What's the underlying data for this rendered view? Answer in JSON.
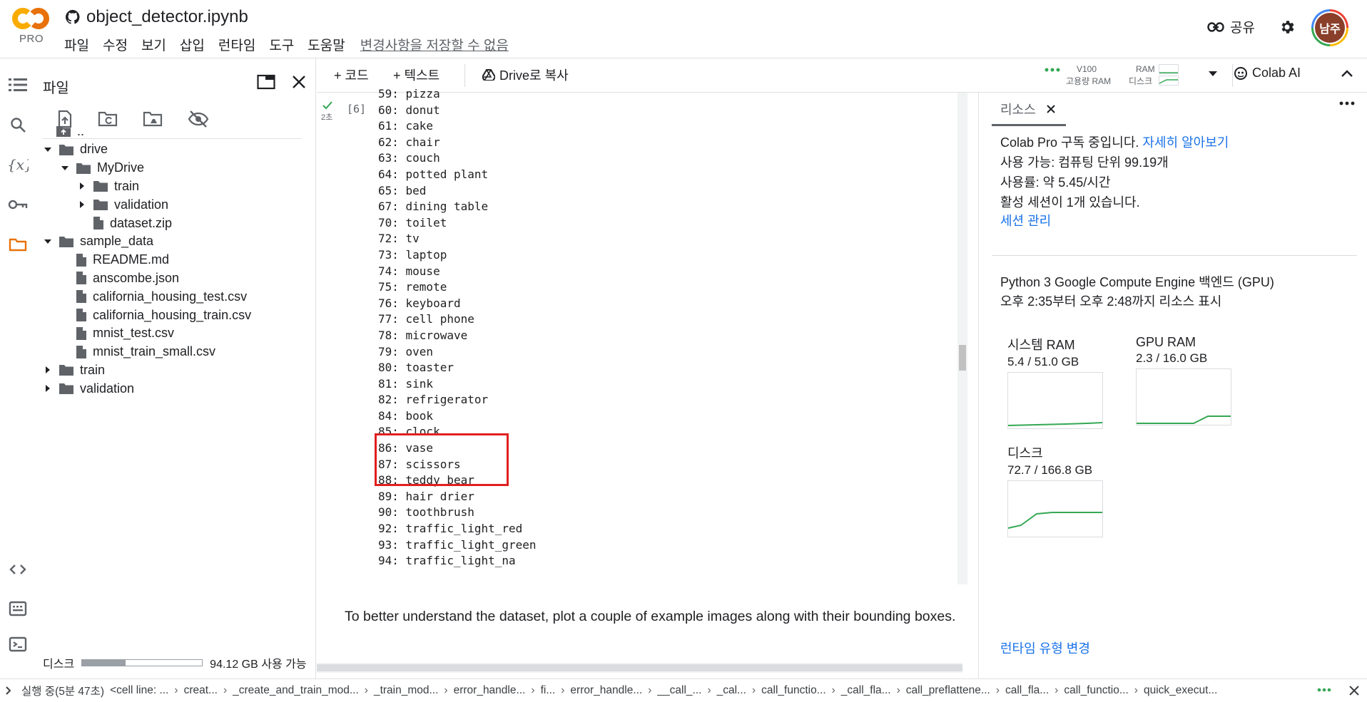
{
  "header": {
    "logo_text": "PRO",
    "notebook_title": "object_detector.ipynb",
    "menu": [
      "파일",
      "수정",
      "보기",
      "삽입",
      "런타임",
      "도구",
      "도움말"
    ],
    "unsaved_notice": "변경사항을 저장할 수 없음",
    "share_label": "공유",
    "avatar_initials": "남주"
  },
  "file_panel": {
    "title": "파일",
    "tree": [
      {
        "label": "..",
        "type": "up"
      },
      {
        "label": "drive",
        "type": "folder",
        "expanded": true
      },
      {
        "label": "MyDrive",
        "type": "folder",
        "expanded": true
      },
      {
        "label": "train",
        "type": "folder",
        "expanded": false
      },
      {
        "label": "validation",
        "type": "folder",
        "expanded": false
      },
      {
        "label": "dataset.zip",
        "type": "file"
      },
      {
        "label": "sample_data",
        "type": "folder",
        "expanded": true
      },
      {
        "label": "README.md",
        "type": "file"
      },
      {
        "label": "anscombe.json",
        "type": "file"
      },
      {
        "label": "california_housing_test.csv",
        "type": "file"
      },
      {
        "label": "california_housing_train.csv",
        "type": "file"
      },
      {
        "label": "mnist_test.csv",
        "type": "file"
      },
      {
        "label": "mnist_train_small.csv",
        "type": "file"
      },
      {
        "label": "train",
        "type": "folder",
        "expanded": false
      },
      {
        "label": "validation",
        "type": "folder",
        "expanded": false
      }
    ],
    "disk_label": "디스크",
    "disk_available": "94.12 GB 사용 가능",
    "disk_used_fraction": 0.36
  },
  "toolbar": {
    "code_label": "+ 코드",
    "text_label": "+ 텍스트",
    "copy_label": "Drive로 복사",
    "gpu_name": "V100",
    "ram_type": "고용량 RAM",
    "ram_label": "RAM",
    "disk_label": "디스크",
    "colab_ai_label": "Colab AI"
  },
  "cell": {
    "exec_count": "[6]",
    "exec_time": "2초",
    "output_lines": [
      "59: pizza",
      "60: donut",
      "61: cake",
      "62: chair",
      "63: couch",
      "64: potted plant",
      "65: bed",
      "67: dining table",
      "70: toilet",
      "72: tv",
      "73: laptop",
      "74: mouse",
      "75: remote",
      "76: keyboard",
      "77: cell phone",
      "78: microwave",
      "79: oven",
      "80: toaster",
      "81: sink",
      "82: refrigerator",
      "84: book",
      "85: clock",
      "86: vase",
      "87: scissors",
      "88: teddy bear",
      "89: hair drier",
      "90: toothbrush",
      "92: traffic_light_red",
      "93: traffic_light_green",
      "94: traffic_light_na"
    ]
  },
  "text_cell": "To better understand the dataset, plot a couple of example images along with their bounding boxes.",
  "resources": {
    "tab_label": "리소스",
    "pro_status": "Colab Pro 구독 중입니다.",
    "learn_more": "자세히 알아보기",
    "units": "사용 가능: 컴퓨팅 단위 99.19개",
    "rate": "사용률: 약 5.45/시간",
    "sessions": "활성 세션이 1개 있습니다.",
    "manage_sessions": "세션 관리",
    "backend": "Python 3 Google Compute Engine 백엔드 (GPU)",
    "time_range": "오후 2:35부터 오후 2:48까지 리소스 표시",
    "gauges": [
      {
        "name": "시스템 RAM",
        "value": "5.4 / 51.0 GB"
      },
      {
        "name": "GPU RAM",
        "value": "2.3 / 16.0 GB"
      },
      {
        "name": "디스크",
        "value": "72.7 / 166.8 GB"
      }
    ],
    "change_runtime": "런타임 유형 변경"
  },
  "statusbar": {
    "running": "실행 중(5분 47초)",
    "stack": [
      "<cell line: ...",
      "creat...",
      "_create_and_train_mod...",
      "_train_mod...",
      "error_handle...",
      "fi...",
      "error_handle...",
      "__call_...",
      "_cal...",
      "call_functio...",
      "_call_fla...",
      "call_preflattene...",
      "call_fla...",
      "call_functio...",
      "quick_execut..."
    ]
  },
  "colors": {
    "accent_orange": "#f9ab00",
    "link_blue": "#1a73e8",
    "highlight_red": "#e0201f",
    "chart_green": "#34a853"
  }
}
